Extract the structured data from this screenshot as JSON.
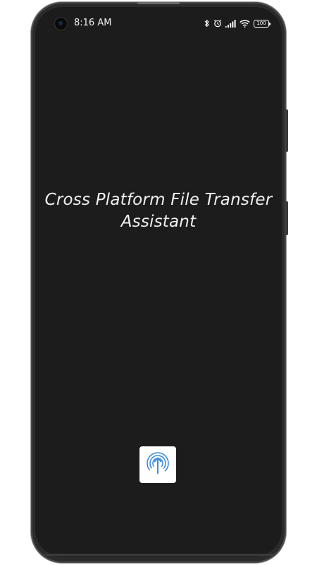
{
  "status_bar": {
    "time": "8:16 AM",
    "battery_level": "100",
    "icons": [
      "camera-icon",
      "bluetooth-icon",
      "alarm-icon",
      "signal-icon",
      "wifi-icon",
      "battery-icon"
    ]
  },
  "splash": {
    "title_line1": "Cross Platform File Transfer",
    "title_line2": "Assistant",
    "app_icon": "upload-cloud-icon"
  },
  "colors": {
    "screen_background": "#1c1c1c",
    "title_text": "#f0f0f0",
    "icon_accent": "#3d8ee0",
    "icon_background": "#ffffff"
  }
}
